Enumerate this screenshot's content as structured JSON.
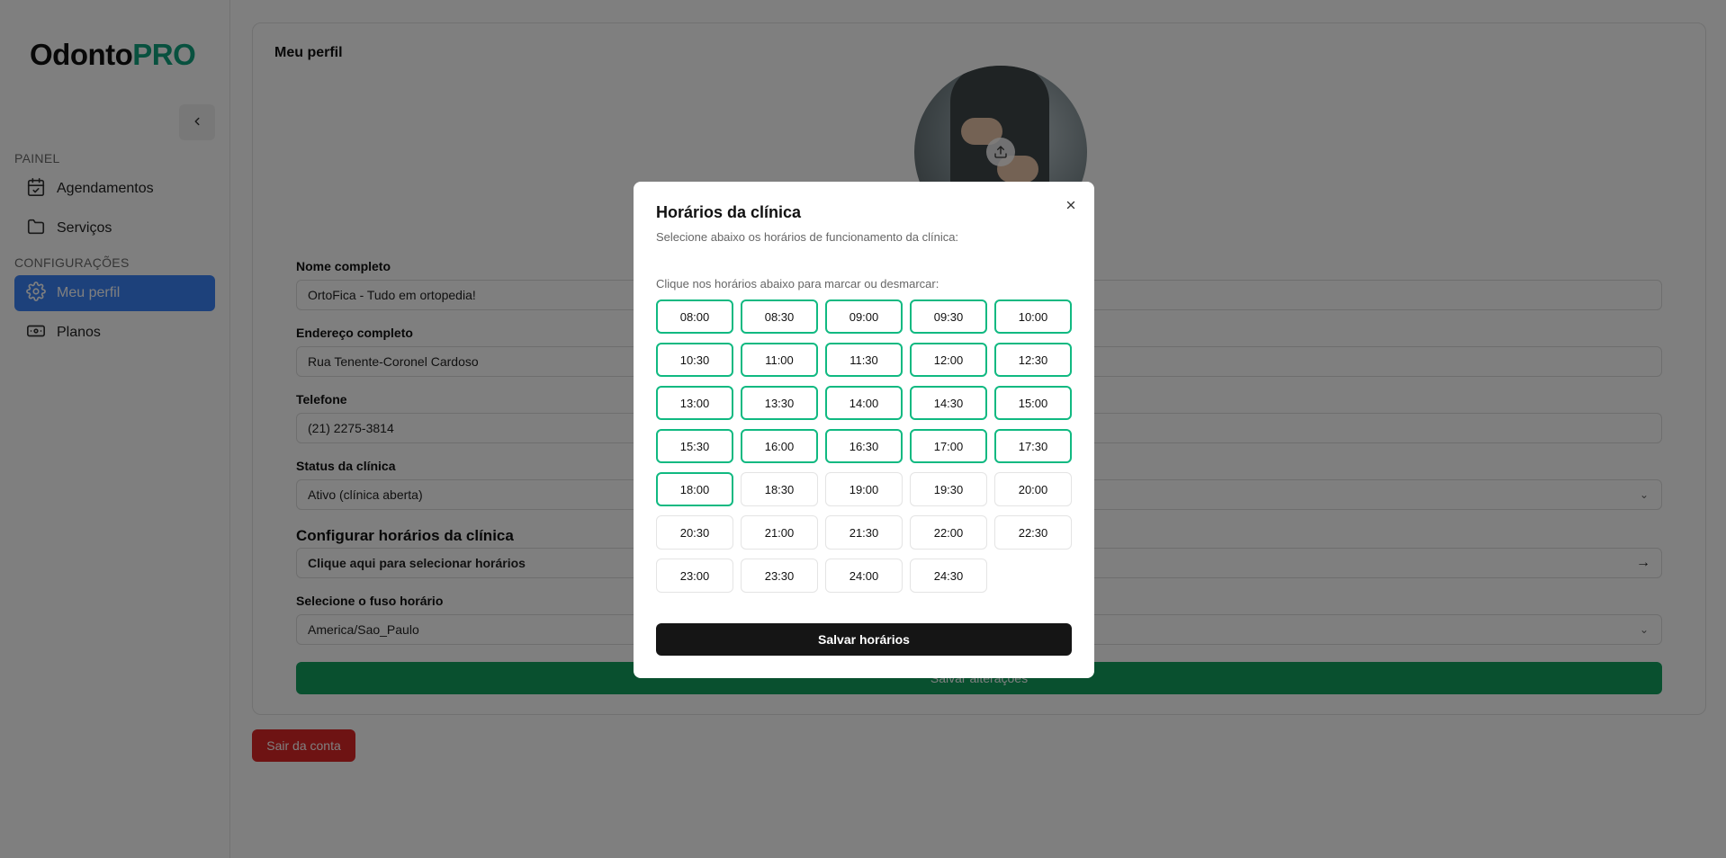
{
  "logo": {
    "prefix": "Odonto",
    "suffix": "PRO"
  },
  "sidebar": {
    "collapse_icon": "chevron-left-icon",
    "sections": [
      {
        "label": "PAINEL"
      },
      {
        "label": "CONFIGURAÇÕES"
      }
    ],
    "items": [
      {
        "label": "Agendamentos",
        "icon": "calendar-check-icon"
      },
      {
        "label": "Serviços",
        "icon": "folder-icon"
      },
      {
        "label": "Meu perfil",
        "icon": "gear-icon",
        "active": true
      },
      {
        "label": "Planos",
        "icon": "banknote-icon"
      }
    ]
  },
  "profile": {
    "title": "Meu perfil",
    "upload_icon": "upload-icon",
    "fields": {
      "name_label": "Nome completo",
      "name_value": "OrtoFica - Tudo em ortopedia!",
      "address_label": "Endereço completo",
      "address_value": "Rua Tenente-Coronel Cardoso",
      "phone_label": "Telefone",
      "phone_value": "(21) 2275-3814",
      "status_label": "Status da clínica",
      "status_value": "Ativo (clínica aberta)",
      "hours_heading": "Configurar horários da clínica",
      "hours_button": "Clique aqui para selecionar horários",
      "timezone_label": "Selecione o fuso horário",
      "timezone_value": "America/Sao_Paulo"
    },
    "save_button": "Salvar alterações",
    "logout_button": "Sair da conta"
  },
  "modal": {
    "title": "Horários da clínica",
    "description": "Selecione abaixo os horários de funcionamento da clínica:",
    "hint": "Clique nos horários abaixo para marcar ou desmarcar:",
    "close_icon": "close-icon",
    "save_button": "Salvar horários",
    "slots": [
      {
        "time": "08:00",
        "selected": true
      },
      {
        "time": "08:30",
        "selected": true
      },
      {
        "time": "09:00",
        "selected": true
      },
      {
        "time": "09:30",
        "selected": true
      },
      {
        "time": "10:00",
        "selected": true
      },
      {
        "time": "10:30",
        "selected": true
      },
      {
        "time": "11:00",
        "selected": true
      },
      {
        "time": "11:30",
        "selected": true
      },
      {
        "time": "12:00",
        "selected": true
      },
      {
        "time": "12:30",
        "selected": true
      },
      {
        "time": "13:00",
        "selected": true
      },
      {
        "time": "13:30",
        "selected": true
      },
      {
        "time": "14:00",
        "selected": true
      },
      {
        "time": "14:30",
        "selected": true
      },
      {
        "time": "15:00",
        "selected": true
      },
      {
        "time": "15:30",
        "selected": true
      },
      {
        "time": "16:00",
        "selected": true
      },
      {
        "time": "16:30",
        "selected": true
      },
      {
        "time": "17:00",
        "selected": true
      },
      {
        "time": "17:30",
        "selected": true
      },
      {
        "time": "18:00",
        "selected": true
      },
      {
        "time": "18:30",
        "selected": false
      },
      {
        "time": "19:00",
        "selected": false
      },
      {
        "time": "19:30",
        "selected": false
      },
      {
        "time": "20:00",
        "selected": false
      },
      {
        "time": "20:30",
        "selected": false
      },
      {
        "time": "21:00",
        "selected": false
      },
      {
        "time": "21:30",
        "selected": false
      },
      {
        "time": "22:00",
        "selected": false
      },
      {
        "time": "22:30",
        "selected": false
      },
      {
        "time": "23:00",
        "selected": false
      },
      {
        "time": "23:30",
        "selected": false
      },
      {
        "time": "24:00",
        "selected": false
      },
      {
        "time": "24:30",
        "selected": false
      }
    ]
  },
  "colors": {
    "brand_accent": "#10a37f",
    "active_nav": "#3b82f6",
    "selected_slot_border": "#10b981",
    "save_changes": "#13a05f",
    "logout": "#dc2626",
    "save_hours": "#151515"
  }
}
